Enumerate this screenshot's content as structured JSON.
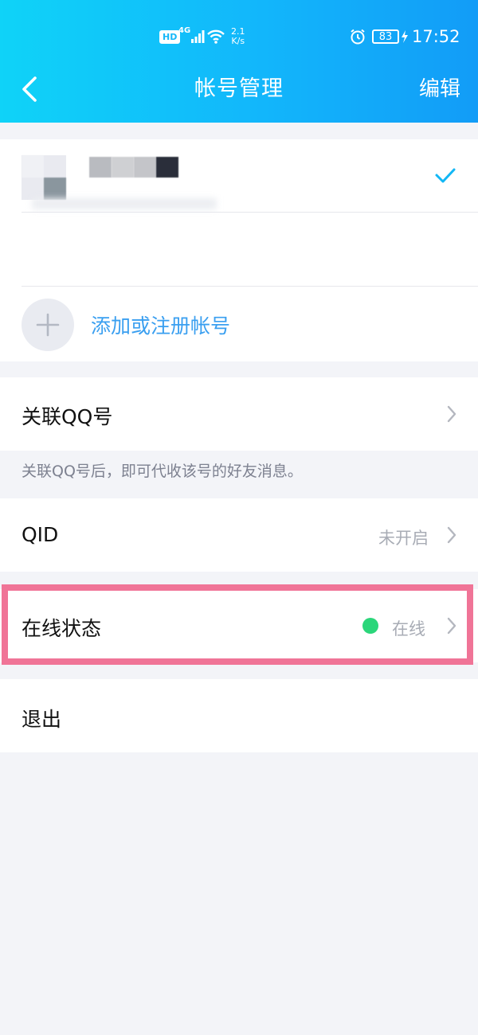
{
  "status_bar": {
    "hd": "HD",
    "network": "4G",
    "speed_value": "2.1",
    "speed_unit": "K/s",
    "battery": "83",
    "time": "17:52"
  },
  "nav": {
    "title": "帐号管理",
    "edit": "编辑"
  },
  "accounts": {
    "add_label": "添加或注册帐号"
  },
  "link_qq": {
    "label": "关联QQ号",
    "hint": "关联QQ号后，即可代收该号的好友消息。"
  },
  "qid": {
    "label": "QID",
    "value": "未开启"
  },
  "online_status": {
    "label": "在线状态",
    "value": "在线",
    "dot_color": "#2bd67a"
  },
  "logout": {
    "label": "退出"
  },
  "colors": {
    "accent": "#3a9ff0",
    "check": "#12b7f5",
    "highlight": "#f07497"
  }
}
